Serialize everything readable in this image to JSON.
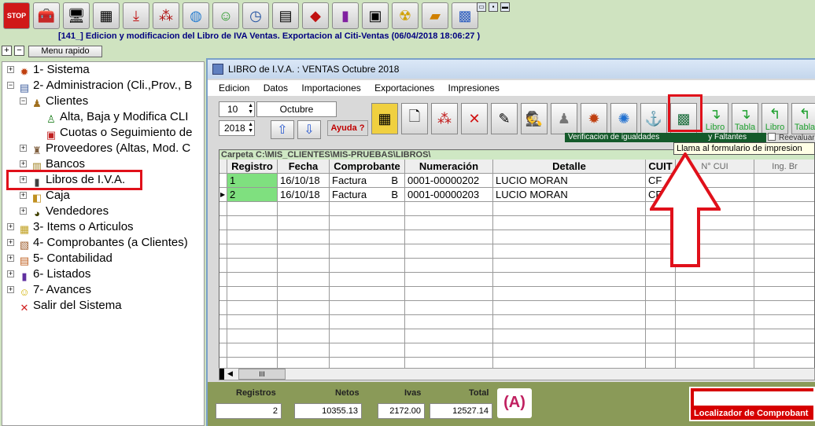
{
  "window_title": "[141_] Edicion y modificacion del Libro de IVA Ventas. Exportacion al Citi-Ventas (06/04/2018 18:06:27  )",
  "toolbar_icons": [
    "stop-icon",
    "tools-icon",
    "computer-icon",
    "folder-icon",
    "download-icon",
    "chart-icon",
    "globe-icon",
    "user-icon",
    "clock-icon",
    "scanner-icon",
    "tag-icon",
    "bars-icon",
    "safe-icon",
    "radiation-icon",
    "folder-open-icon",
    "image-icon"
  ],
  "quick": {
    "plus": "+",
    "minus": "−",
    "menu_rapido": "Menu rapido"
  },
  "tree": {
    "items": [
      {
        "label": "1- Sistema",
        "icon": "gear-icon",
        "level": 0
      },
      {
        "label": "2- Administracion (Cli.,Prov., B",
        "icon": "admin-icon",
        "level": 0
      },
      {
        "label": "Clientes",
        "icon": "clients-icon",
        "level": 1
      },
      {
        "label": "Alta, Baja y Modifica CLI",
        "icon": "edit-client-icon",
        "level": 2
      },
      {
        "label": "Cuotas o Seguimiento de",
        "icon": "dues-icon",
        "level": 2
      },
      {
        "label": "Proveedores (Altas, Mod. C",
        "icon": "suppliers-icon",
        "level": 1
      },
      {
        "label": "Bancos",
        "icon": "bank-icon",
        "level": 1
      },
      {
        "label": "Libros de I.V.A.",
        "icon": "books-icon",
        "level": 1
      },
      {
        "label": "Caja",
        "icon": "cashbox-icon",
        "level": 1
      },
      {
        "label": "Vendedores",
        "icon": "sellers-icon",
        "level": 1
      },
      {
        "label": "3- Items o Articulos",
        "icon": "items-icon",
        "level": 0
      },
      {
        "label": "4- Comprobantes (a Clientes)",
        "icon": "vouchers-icon",
        "level": 0
      },
      {
        "label": "5- Contabilidad",
        "icon": "accounting-icon",
        "level": 0
      },
      {
        "label": "6- Listados",
        "icon": "lists-icon",
        "level": 0
      },
      {
        "label": "7- Avances",
        "icon": "smiley-icon",
        "level": 0
      },
      {
        "label": "Salir del Sistema",
        "icon": "exit-icon",
        "level": 0
      }
    ]
  },
  "libro": {
    "title": "LIBRO de I.V.A. : VENTAS Octubre 2018",
    "menu": [
      "Edicion",
      "Datos",
      "Importaciones",
      "Exportaciones",
      "Impresiones"
    ],
    "month_num": "10",
    "month_name": "Octubre",
    "year": "2018",
    "ayuda": "Ayuda ?",
    "carpeta": "Carpeta C:\\MIS_CLIENTES\\MIS-PRUEBAS\\LIBROS\\",
    "columns": [
      "Registro",
      "Fecha",
      "Comprobante",
      "Numeración",
      "Detalle",
      "CUIT"
    ],
    "rows": [
      {
        "registro": "1",
        "fecha": "16/10/18",
        "comprobante": "Factura",
        "letra": "B",
        "numeracion": "0001-00000202",
        "detalle": "LUCIO MORAN",
        "cuit": "CF"
      },
      {
        "registro": "2",
        "fecha": "16/10/18",
        "comprobante": "Factura",
        "letra": "B",
        "numeracion": "0001-00000203",
        "detalle": "LUCIO MORAN",
        "cuit": "CF"
      }
    ],
    "hscroll_label": "III",
    "buttons": {
      "libro1": "Libro",
      "tabla1": "Tabla",
      "libro2": "Libro",
      "tabla2": "Tabla"
    },
    "verificacion": "Verificacion de igualdades",
    "faltantes": "y Faltantes",
    "tooltip": "Llama al formulario de impresion",
    "reevaluar": "Reevaluar",
    "hidden_col": "N° CUI",
    "hidden_col2": "Ing. Br",
    "totals": {
      "registros_label": "Registros",
      "registros": "2",
      "netos_label": "Netos",
      "netos": "10355.13",
      "ivas_label": "Ivas",
      "ivas": "2172.00",
      "total_label": "Total",
      "total": "12527.14"
    },
    "localizador": "Localizador de Comprobant"
  }
}
